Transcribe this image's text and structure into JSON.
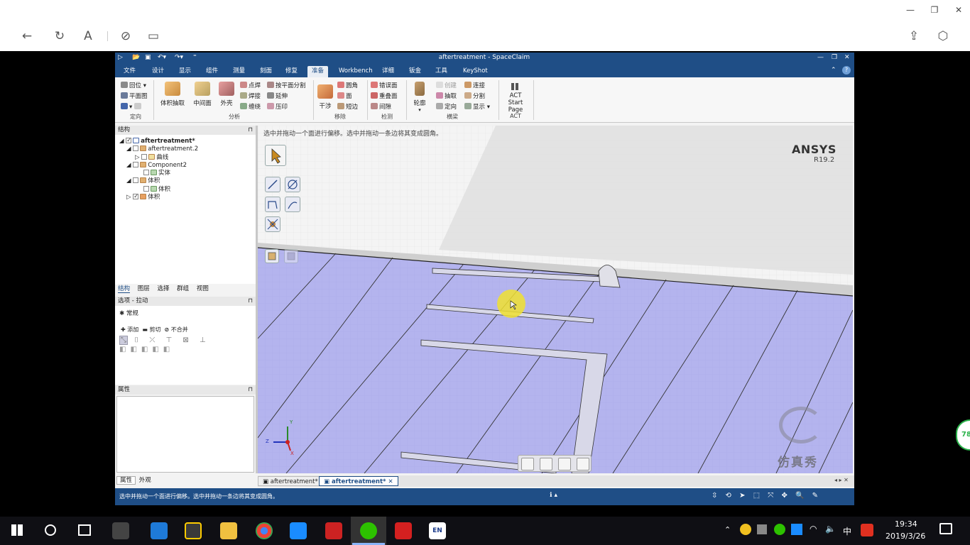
{
  "app": {
    "window_title": "aftertreatment - SpaceClaim",
    "menus": [
      "文件",
      "设计",
      "显示",
      "组件",
      "测量",
      "刻面",
      "修复",
      "准备",
      "Workbench",
      "详细",
      "钣金",
      "工具",
      "KeyShot"
    ],
    "active_menu": "准备"
  },
  "ribbon": {
    "orient": {
      "items": [
        "回位",
        "平面图"
      ],
      "label": "定向"
    },
    "analyze": {
      "big": [
        "体积抽取",
        "中间面",
        "外壳"
      ],
      "col1": [
        "点焊",
        "焊接",
        "缠绕"
      ],
      "col2": [
        "按平面分割",
        "延伸",
        "压印"
      ],
      "label": "分析"
    },
    "remove": {
      "big": "干涉",
      "col": [
        "圆角",
        "面",
        "短边"
      ],
      "label": "移除"
    },
    "detect": {
      "col": [
        "错误面",
        "重叠面",
        "间隙"
      ],
      "label": "检测"
    },
    "beam": {
      "big": "轮廓",
      "col1": [
        "创建",
        "抽取",
        "定向"
      ],
      "col2": [
        "连接",
        "分割",
        "显示"
      ],
      "label": "横梁"
    },
    "act": {
      "big_line1": "ACT Start",
      "big_line2": "Page",
      "label": "ACT"
    }
  },
  "structure": {
    "header": "结构",
    "tree": [
      {
        "label": "aftertreatment*",
        "bold": true,
        "checked": true,
        "indent": 0
      },
      {
        "label": "aftertreatment.2",
        "checked": false,
        "indent": 1
      },
      {
        "label": "曲线",
        "checked": false,
        "indent": 2
      },
      {
        "label": "Component2",
        "checked": false,
        "indent": 1
      },
      {
        "label": "实体",
        "checked": false,
        "indent": 2
      },
      {
        "label": "体积",
        "checked": false,
        "indent": 1
      },
      {
        "label": "体积",
        "checked": false,
        "indent": 2
      },
      {
        "label": "体积",
        "checked": true,
        "indent": 1
      }
    ],
    "tabs": [
      "结构",
      "图层",
      "选择",
      "群组",
      "视图"
    ]
  },
  "options": {
    "header": "选项 - 拉动",
    "section": "常规",
    "modes": [
      "添加",
      "剪切",
      "不合并"
    ]
  },
  "properties": {
    "header": "属性",
    "tabs": [
      "属性",
      "外观"
    ]
  },
  "viewport": {
    "hint": "选中并拖动一个面进行偏移。选中并拖动一条边将其变成圆角。",
    "brand": "ANSYS",
    "version": "R19.2",
    "watermark": "仿真秀",
    "axes": {
      "y": "Y",
      "z": "Z",
      "x": "X"
    }
  },
  "doc_tabs": [
    {
      "label": "aftertreatment*",
      "active": false
    },
    {
      "label": "aftertreatment*",
      "active": true
    }
  ],
  "status": {
    "text": "选中并拖动一个面进行偏移。选中并拖动一条边将其变成圆角。"
  },
  "taskbar": {
    "ime": "中",
    "time": "19:34",
    "date": "2019/3/26"
  },
  "edge_badge": "78"
}
